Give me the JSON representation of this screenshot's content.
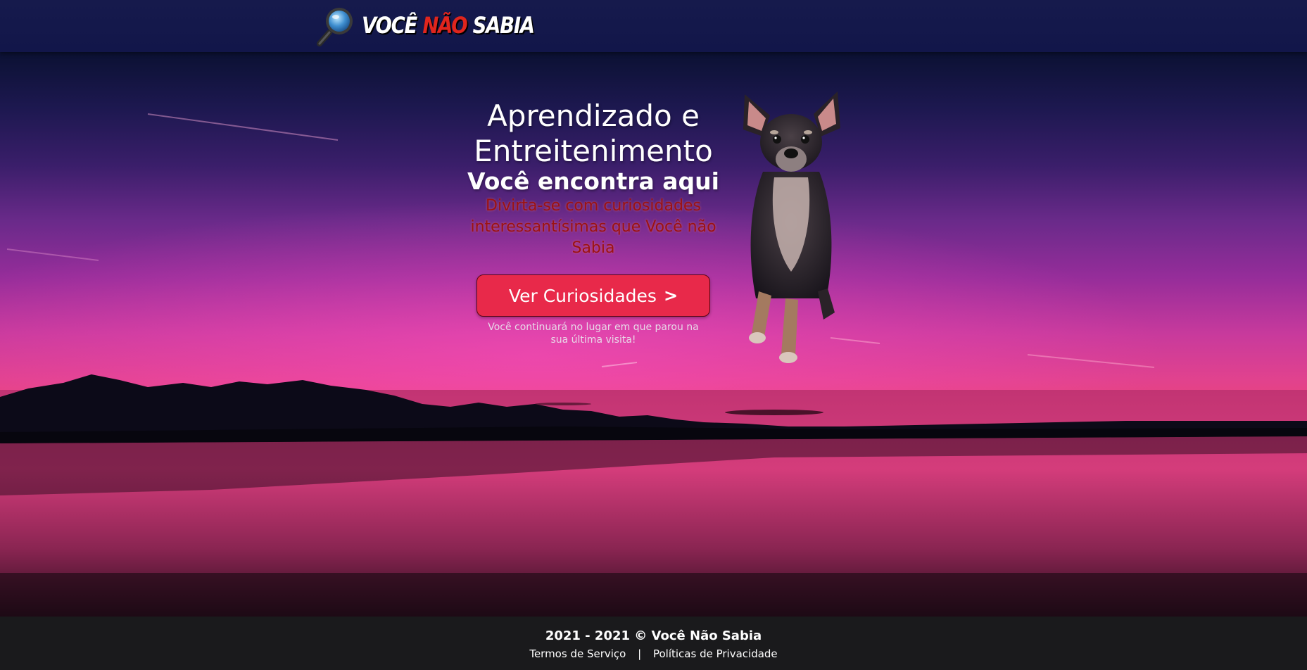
{
  "brand": {
    "part1": "VOCÊ",
    "part2": "NÃO",
    "part3": "SABIA",
    "accent_color": "#e0251d"
  },
  "hero": {
    "title": "Aprendizado e Entreitenimento",
    "subtitle": "Você encontra aqui",
    "tagline": "Divirta-se com curiosidades interessantísimas que Você não Sabia",
    "cta_label": "Ver Curiosidades",
    "cta_chevron": ">",
    "note": "Você continuará no lugar em que parou na sua última visita!",
    "cta_color": "#e8294a"
  },
  "footer": {
    "copyright": "2021 - 2021 © Você Não Sabia",
    "terms": "Termos de Serviço",
    "separator": "|",
    "privacy": "Políticas de Privacidade"
  },
  "icons": {
    "logo": "magnifying-glass-icon",
    "cta": "chevron-right-icon"
  }
}
